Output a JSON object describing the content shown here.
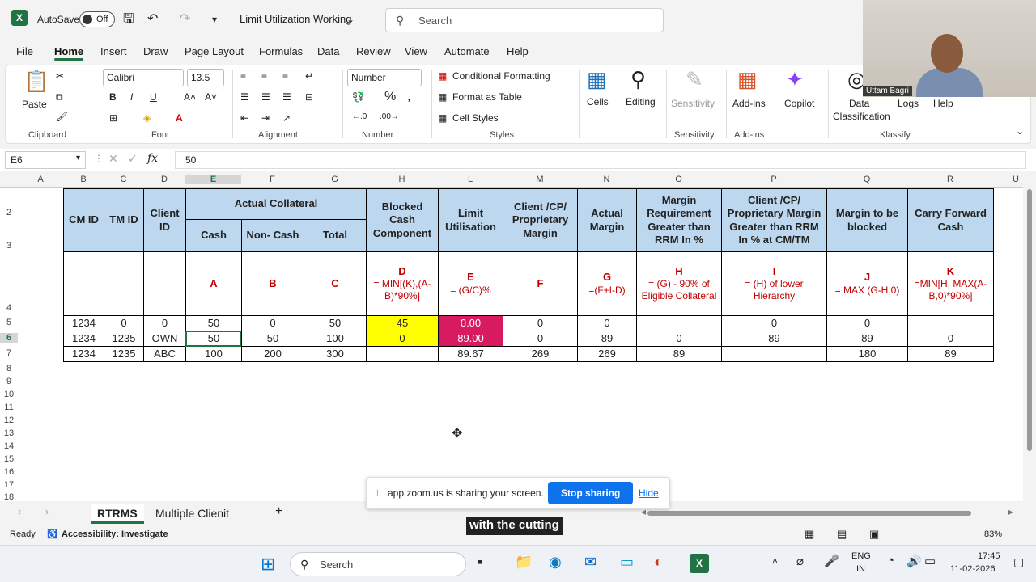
{
  "titlebar": {
    "autosave": "AutoSave",
    "toggle": "Off",
    "doc_title": "Limit Utilization Working",
    "search_placeholder": "Search"
  },
  "menu": [
    "File",
    "Home",
    "Insert",
    "Draw",
    "Page Layout",
    "Formulas",
    "Data",
    "Review",
    "View",
    "Automate",
    "Help"
  ],
  "ribbon": {
    "paste": "Paste",
    "clipboard": "Clipboard",
    "font_name": "Calibri",
    "font_size": "13.5",
    "font": "Font",
    "alignment": "Alignment",
    "number_format": "Number",
    "number": "Number",
    "cond_format": "Conditional Formatting",
    "format_table": "Format as Table",
    "cell_styles": "Cell Styles",
    "styles": "Styles",
    "cells": "Cells",
    "editing": "Editing",
    "sensitivity_btn": "Sensitivity",
    "sensitivity": "Sensitivity",
    "addins_btn": "Add-ins",
    "addins": "Add-ins",
    "copilot": "Copilot",
    "data_class": "Data",
    "data_class2": "Classification",
    "logs": "Logs",
    "help": "Help",
    "klassify": "Klassify"
  },
  "formula": {
    "namebox": "E6",
    "content": "50"
  },
  "columns": [
    "A",
    "B",
    "C",
    "D",
    "E",
    "F",
    "G",
    "H",
    "L",
    "M",
    "N",
    "O",
    "P",
    "Q",
    "R",
    "U"
  ],
  "rows": [
    "2",
    "3",
    "4",
    "5",
    "6",
    "7",
    "8",
    "9",
    "10",
    "11",
    "12",
    "13",
    "14",
    "15",
    "16",
    "17",
    "18"
  ],
  "sheet": {
    "h_cmid": "CM ID",
    "h_tmid": "TM ID",
    "h_client": "Client ID",
    "h_actual": "Actual Collateral",
    "h_cash": "Cash",
    "h_noncash": "Non- Cash",
    "h_total": "Total",
    "h_blocked": "Blocked Cash Component",
    "h_limit": "Limit Utilisation",
    "h_clientmargin": "Client /CP/ Proprietary Margin",
    "h_actualmargin": "Actual Margin",
    "h_marginreq": "Margin Requirement Greater than RRM In %",
    "h_clientprop": "Client /CP/ Proprietary Margin Greater than RRM In % at CM/TM",
    "h_tobeblocked": "Margin to be blocked",
    "h_carry": "Carry Forward Cash",
    "f_a": "A",
    "f_b": "B",
    "f_c": "C",
    "f_d": "D",
    "f_d2": "= MIN[(K),(A-B)*90%]",
    "f_e": "E",
    "f_e2": "= (G/C)%",
    "f_f": "F",
    "f_g": "G",
    "f_g2": "=(F+I-D)",
    "f_h": "H",
    "f_h2": "= (G) - 90% of Eligible Collateral",
    "f_i": "I",
    "f_i2": "= (H) of lower Hierarchy",
    "f_j": "J",
    "f_j2": "= MAX (G-H,0)",
    "f_k": "K",
    "f_k2": "=MIN[H, MAX(A-B,0)*90%]",
    "data": [
      [
        "1234",
        "0",
        "0",
        "50",
        "0",
        "50",
        "45",
        "0.00",
        "0",
        "0",
        "",
        "0",
        "0",
        ""
      ],
      [
        "1234",
        "1235",
        "OWN",
        "50",
        "50",
        "100",
        "0",
        "89.00",
        "0",
        "89",
        "0",
        "89",
        "89",
        "0"
      ],
      [
        "1234",
        "1235",
        "ABC",
        "100",
        "200",
        "300",
        "",
        "89.67",
        "269",
        "269",
        "89",
        "",
        "180",
        "89"
      ]
    ]
  },
  "tabs": {
    "sheet1": "RTRMS",
    "sheet2": "Multiple Clienit"
  },
  "status": {
    "ready": "Ready",
    "access": "Accessibility: Investigate",
    "zoom": "83%"
  },
  "zoomshare": {
    "text": "app.zoom.us is sharing your screen.",
    "stop": "Stop sharing",
    "hide": "Hide"
  },
  "caption": "with the cutting",
  "webcam": {
    "name": "Uttam Bagri"
  },
  "taskbar": {
    "search": "Search",
    "lang1": "ENG",
    "lang2": "IN",
    "time": "17:45",
    "date": "11-02-2026"
  }
}
